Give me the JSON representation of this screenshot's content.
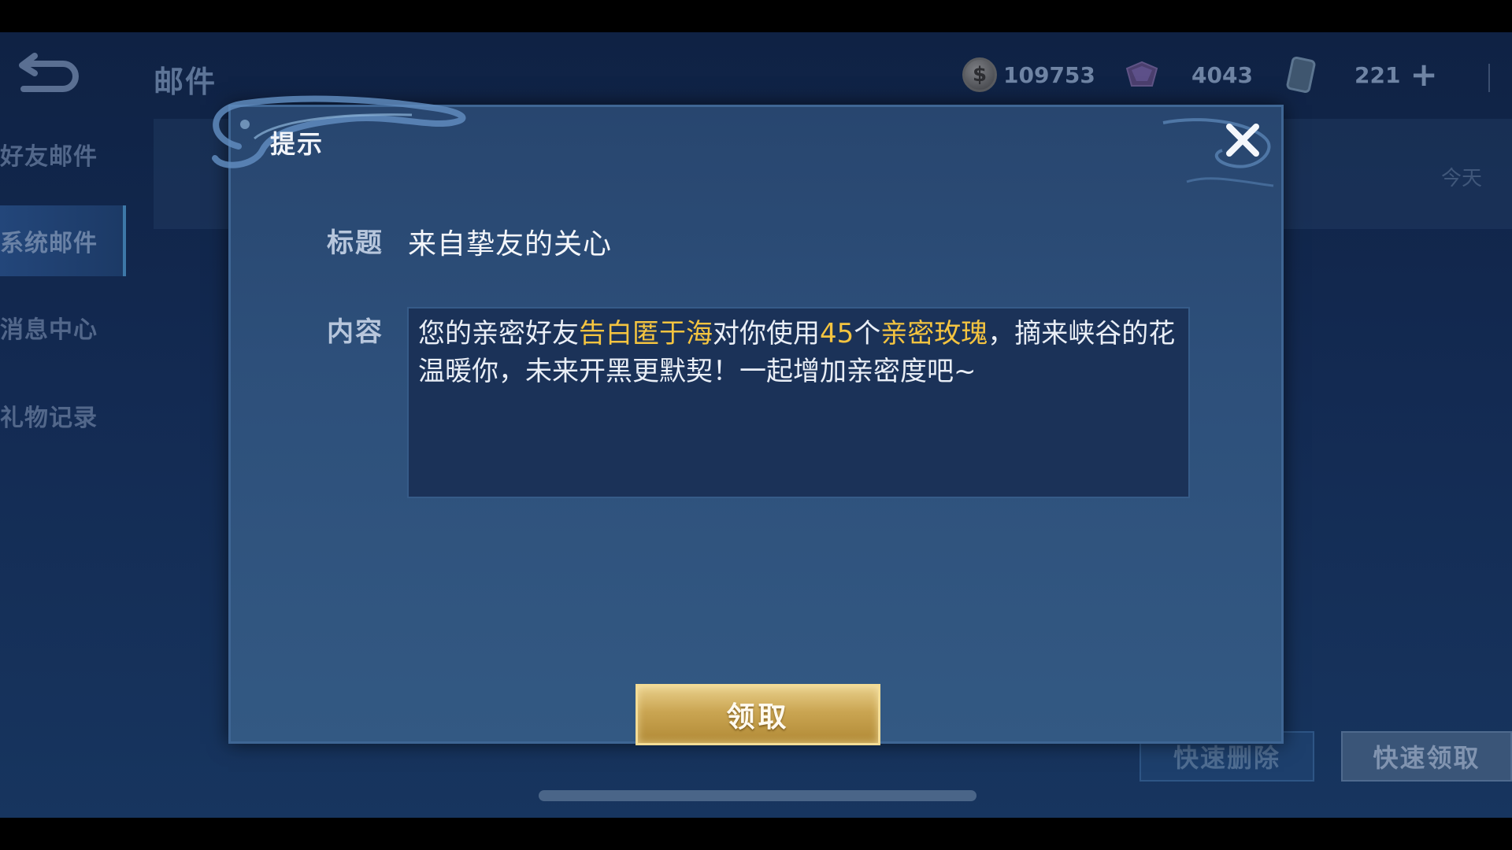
{
  "background": {
    "page_title": "邮件",
    "currencies": [
      {
        "icon": "coin-icon",
        "value": "109753"
      },
      {
        "icon": "gem-icon",
        "value": "4043"
      },
      {
        "icon": "ticket-icon",
        "value": "221"
      }
    ],
    "sidebar": [
      {
        "label": "好友邮件",
        "active": false
      },
      {
        "label": "系统邮件",
        "active": true
      },
      {
        "label": "消息中心",
        "active": false
      },
      {
        "label": "礼物记录",
        "active": false
      }
    ],
    "mail_date": "今天",
    "quick_delete_label": "快速删除",
    "quick_claim_label": "快速领取"
  },
  "dialog": {
    "title": "提示",
    "subject_label": "标题",
    "subject": "来自挚友的关心",
    "content_label": "内容",
    "content_parts": [
      {
        "text": "您的亲密好友",
        "highlight": false
      },
      {
        "text": "告白匿于海",
        "highlight": true
      },
      {
        "text": "对你使用",
        "highlight": false
      },
      {
        "text": "45",
        "highlight": true
      },
      {
        "text": "个",
        "highlight": false
      },
      {
        "text": "亲密玫瑰",
        "highlight": true
      },
      {
        "text": "，摘来峡谷的花温暖你，未来开黑更默契！一起增加亲密度吧~",
        "highlight": false
      }
    ],
    "claim_label": "领取"
  },
  "colors": {
    "highlight": "#f4c440",
    "gold_button": "#caa552",
    "dialog_bg": "#2d4f7a"
  }
}
